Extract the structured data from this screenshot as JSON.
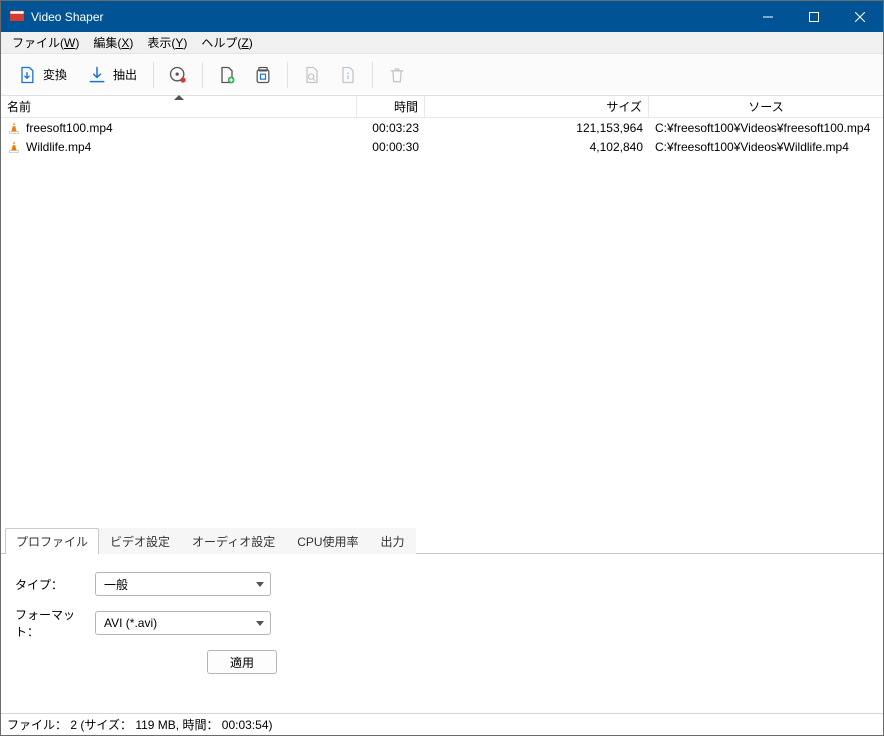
{
  "window": {
    "title": "Video Shaper"
  },
  "menu": {
    "file": {
      "label": "ファイル",
      "mn": "W"
    },
    "edit": {
      "label": "編集",
      "mn": "X"
    },
    "view": {
      "label": "表示",
      "mn": "Y"
    },
    "help": {
      "label": "ヘルプ",
      "mn": "Z"
    }
  },
  "toolbar": {
    "convert": "変換",
    "extract": "抽出"
  },
  "columns": {
    "name": "名前",
    "time": "時間",
    "size": "サイズ",
    "source": "ソース"
  },
  "rows": [
    {
      "name": "freesoft100.mp4",
      "time": "00:03:23",
      "size": "121,153,964",
      "source": "C:¥freesoft100¥Videos¥freesoft100.mp4"
    },
    {
      "name": "Wildlife.mp4",
      "time": "00:00:30",
      "size": "4,102,840",
      "source": "C:¥freesoft100¥Videos¥Wildlife.mp4"
    }
  ],
  "tabs": {
    "profile": "プロファイル",
    "video": "ビデオ設定",
    "audio": "オーディオ設定",
    "cpu": "CPU使用率",
    "output": "出力"
  },
  "profile_form": {
    "type_label": "タイプ：",
    "type_value": "一般",
    "format_label": "フォーマット：",
    "format_value": "AVI (*.avi)",
    "apply": "適用"
  },
  "status": {
    "text": "ファイル： 2 (サイズ： 119 MB, 時間： 00:03:54)"
  }
}
